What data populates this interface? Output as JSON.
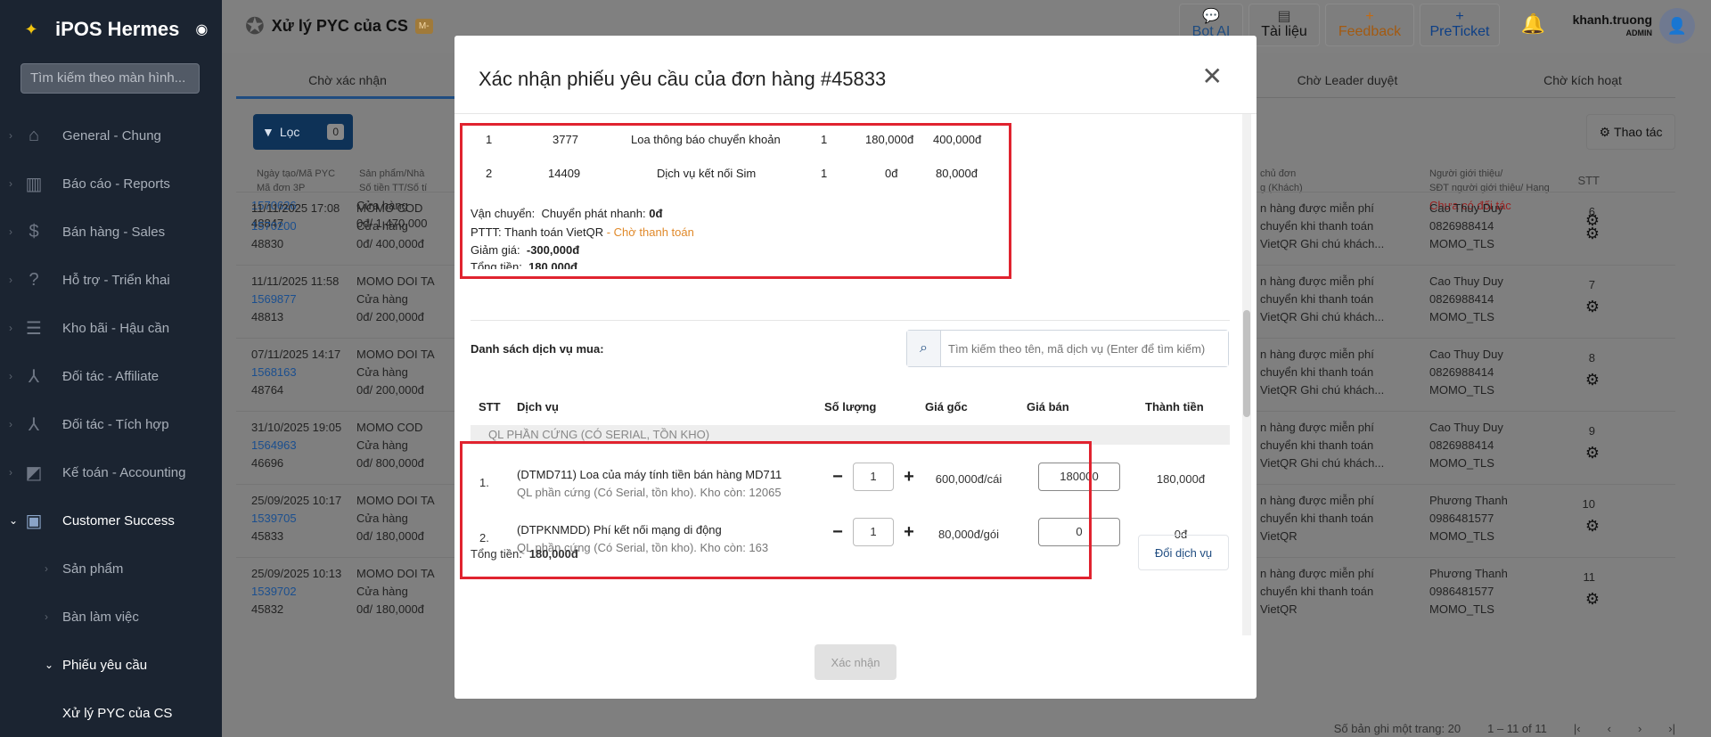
{
  "sidebar": {
    "app_title": "iPOS Hermes",
    "search_placeholder": "Tìm kiếm theo màn hình...",
    "items": [
      {
        "label": "General - Chung",
        "icon": "home-icon"
      },
      {
        "label": "Báo cáo - Reports",
        "icon": "chart-icon"
      },
      {
        "label": "Bán hàng - Sales",
        "icon": "dollar-icon"
      },
      {
        "label": "Hỗ trợ - Triển khai",
        "icon": "help-icon"
      },
      {
        "label": "Kho bãi - Hậu cần",
        "icon": "warehouse-icon"
      },
      {
        "label": "Đối tác - Affiliate",
        "icon": "network-icon"
      },
      {
        "label": "Đối tác - Tích hợp",
        "icon": "network-icon"
      },
      {
        "label": "Kế toán - Accounting",
        "icon": "accounting-icon"
      },
      {
        "label": "Customer Success",
        "icon": "customer-icon"
      }
    ],
    "subitems": [
      {
        "label": "Sản phẩm"
      },
      {
        "label": "Bàn làm việc"
      },
      {
        "label": "Phiếu yêu cầu"
      },
      {
        "label": "Xử lý PYC của CS"
      }
    ]
  },
  "topbar": {
    "title": "Xử lý PYC của CS",
    "badge": "M-",
    "bot_ai": "Bot AI",
    "docs": "Tài liệu",
    "feedback": "Feedback",
    "preticket": "PreTicket",
    "user_name": "khanh.truong",
    "user_role": "ADMIN"
  },
  "tabs": [
    "Chờ xác nhận",
    "Chờ Leader duyệt",
    "Chờ kích hoạt"
  ],
  "filter": {
    "label": "Lọc",
    "count": "0"
  },
  "action_label": "Thao tác",
  "table": {
    "headers": {
      "date": [
        "Ngày tạo/Mã PYC",
        "Mã đơn 3P"
      ],
      "product": [
        "Sản phẩm/Nhà",
        "Số tiền TT/Số tí"
      ],
      "owner": [
        "chủ đơn",
        "g (Khách)"
      ],
      "referrer": [
        "Người giới thiệu/",
        "SĐT người giới thiệu/ Hạng"
      ],
      "stt": "STT"
    },
    "rows": [
      {
        "date": "",
        "pyc": "1570626",
        "order": "48847",
        "product": "Cửa hàng",
        "amount": "0đ/ 1,470,000",
        "owner": [
          "",
          "",
          ""
        ],
        "ref": [
          "Chưa có đối tác",
          "",
          ""
        ],
        "stt": ""
      },
      {
        "date": "11/11/2025 17:08",
        "pyc": "1570200",
        "order": "48830",
        "product_name": "MOMO COD",
        "product": "Cửa hàng",
        "amount": "0đ/ 400,000đ",
        "owner": [
          "n hàng được miễn phí",
          "chuyển khi thanh toán",
          "VietQR Ghi chú khách..."
        ],
        "ref": [
          "Cao Thuy Duy",
          "0826988414",
          "MOMO_TLS"
        ],
        "stt": "6"
      },
      {
        "date": "11/11/2025 11:58",
        "pyc": "1569877",
        "order": "48813",
        "product_name": "MOMO DOI TA",
        "product": "Cửa hàng",
        "amount": "0đ/ 200,000đ",
        "owner": [
          "n hàng được miễn phí",
          "chuyển khi thanh toán",
          "VietQR Ghi chú khách..."
        ],
        "ref": [
          "Cao Thuy Duy",
          "0826988414",
          "MOMO_TLS"
        ],
        "stt": "7"
      },
      {
        "date": "07/11/2025 14:17",
        "pyc": "1568163",
        "order": "48764",
        "product_name": "MOMO DOI TA",
        "product": "Cửa hàng",
        "amount": "0đ/ 200,000đ",
        "owner": [
          "n hàng được miễn phí",
          "chuyển khi thanh toán",
          "VietQR Ghi chú khách..."
        ],
        "ref": [
          "Cao Thuy Duy",
          "0826988414",
          "MOMO_TLS"
        ],
        "stt": "8"
      },
      {
        "date": "31/10/2025 19:05",
        "pyc": "1564963",
        "order": "46696",
        "product_name": "MOMO COD",
        "product": "Cửa hàng",
        "amount": "0đ/ 800,000đ",
        "owner": [
          "n hàng được miễn phí",
          "chuyển khi thanh toán",
          "VietQR Ghi chú khách..."
        ],
        "ref": [
          "Cao Thuy Duy",
          "0826988414",
          "MOMO_TLS"
        ],
        "stt": "9"
      },
      {
        "date": "25/09/2025 10:17",
        "pyc": "1539705",
        "order": "45833",
        "product_name": "MOMO DOI TA",
        "product": "Cửa hàng",
        "amount": "0đ/ 180,000đ",
        "owner": [
          "n hàng được miễn phí",
          "chuyển khi thanh toán",
          "VietQR"
        ],
        "ref": [
          "Phương Thanh",
          "0986481577",
          "MOMO_TLS"
        ],
        "stt": "10"
      },
      {
        "date": "25/09/2025 10:13",
        "pyc": "1539702",
        "order": "45832",
        "product_name": "MOMO DOI TA",
        "product": "Cửa hàng",
        "amount": "0đ/ 180,000đ",
        "owner": [
          "n hàng được miễn phí",
          "chuyển khi thanh toán",
          "VietQR"
        ],
        "ref": [
          "Phương Thanh",
          "0986481577",
          "MOMO_TLS"
        ],
        "stt": "11"
      }
    ]
  },
  "pager": {
    "per_page": "Số bản ghi một trang: 20",
    "range": "1 – 11 of 11"
  },
  "modal": {
    "title": "Xác nhận phiếu yêu cầu của đơn hàng #45833",
    "order_items": [
      {
        "stt": "1",
        "code": "3777",
        "name": "Loa thông báo chuyển khoản",
        "qty": "1",
        "price": "180,000đ",
        "total": "400,000đ"
      },
      {
        "stt": "2",
        "code": "14409",
        "name": "Dịch vụ kết nối Sim",
        "qty": "1",
        "price": "0đ",
        "total": "80,000đ"
      }
    ],
    "shipping_label": "Vận chuyển:",
    "shipping_value": "Chuyển phát nhanh:",
    "shipping_fee": "0đ",
    "payment_label": "PTTT: Thanh toán VietQR",
    "payment_status": "- Chờ thanh toán",
    "discount_label": "Giảm giá:",
    "discount_value": "-300,000đ",
    "total_label": "Tổng tiền:",
    "total_value": "180,000đ",
    "svc_list_label": "Danh sách dịch vụ mua:",
    "svc_search_placeholder": "Tìm kiếm theo tên, mã dịch vụ (Enter để tìm kiếm)",
    "svc_headers": {
      "stt": "STT",
      "service": "Dịch vụ",
      "qty": "Số lượng",
      "base": "Giá gốc",
      "sale": "Giá bán",
      "total": "Thành tiền"
    },
    "group_label": "QL PHẦN CỨNG (CÓ SERIAL, TỒN KHO)",
    "services": [
      {
        "idx": "1.",
        "name": "(DTMD711) Loa của máy tính tiền bán hàng MD711",
        "sub": "QL phần cứng (Có Serial, tồn kho). Kho còn: 12065",
        "qty": "1",
        "base": "600,000đ/cái",
        "sale": "180000",
        "total": "180,000đ"
      },
      {
        "idx": "2.",
        "name": "(DTPKNMDD) Phí kết nối mạng di động",
        "sub": "QL phần cứng (Có Serial, tồn kho). Kho còn: 163",
        "qty": "1",
        "base": "80,000đ/gói",
        "sale": "0",
        "total": "0đ"
      }
    ],
    "total2_label": "Tổng tiền:",
    "total2_value": "180,000đ",
    "change_label": "Đổi dịch vụ",
    "confirm_label": "Xác nhận",
    "minus": "−",
    "plus": "+"
  }
}
